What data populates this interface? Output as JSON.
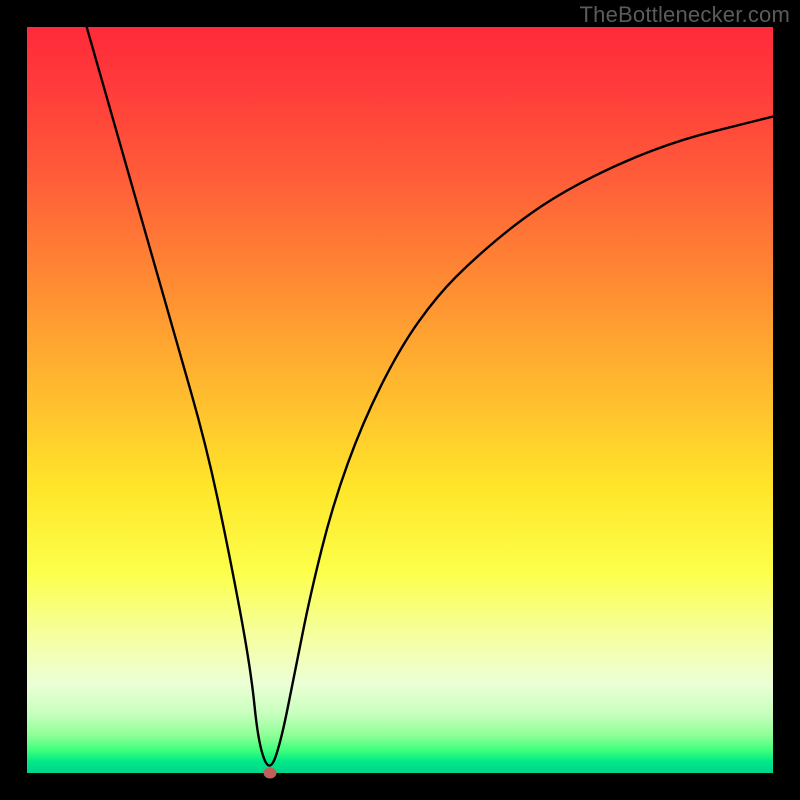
{
  "watermark": "TheBottlenecker.com",
  "colors": {
    "frame": "#000000",
    "watermark_text": "#5b5b5b",
    "curve_stroke": "#000000",
    "marker_fill": "#c06058",
    "gradient_stops": [
      "#ff2a3a",
      "#ff3b3b",
      "#ff5c39",
      "#ff8a33",
      "#ffb82f",
      "#ffe62a",
      "#fcff4a",
      "#f5ffa4",
      "#ecffd6",
      "#c8ffbe",
      "#8cff96",
      "#3cff7e",
      "#00e887",
      "#00d48a"
    ]
  },
  "chart_data": {
    "type": "line",
    "title": "",
    "xlabel": "",
    "ylabel": "",
    "xlim": [
      0,
      100
    ],
    "ylim": [
      0,
      100
    ],
    "grid": false,
    "legend": false,
    "annotations": [
      "TheBottlenecker.com"
    ],
    "series": [
      {
        "name": "bottleneck-curve",
        "x": [
          8,
          12,
          16,
          20,
          24,
          27,
          30,
          31,
          32.5,
          34,
          36,
          38,
          41,
          45,
          50,
          55,
          60,
          66,
          72,
          80,
          88,
          96,
          100
        ],
        "values": [
          100,
          86,
          72,
          58,
          44,
          30,
          14,
          4,
          0,
          4,
          14,
          24,
          36,
          47,
          57,
          64,
          69,
          74,
          78,
          82,
          85,
          87,
          88
        ]
      }
    ],
    "marker": {
      "x": 32.5,
      "y": 0
    }
  }
}
